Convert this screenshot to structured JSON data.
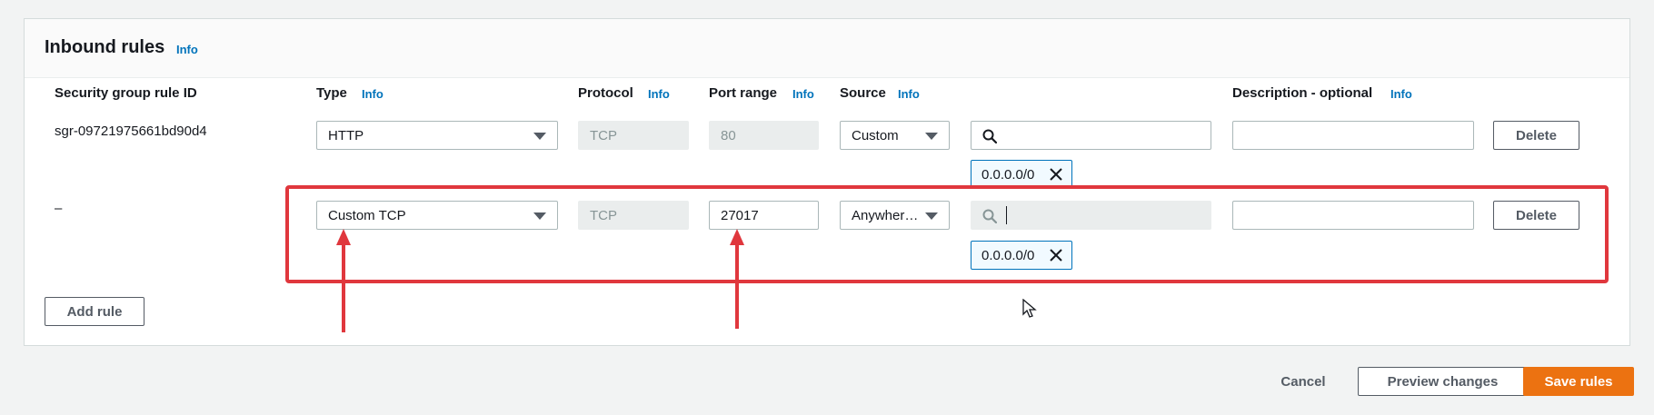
{
  "section": {
    "title": "Inbound rules",
    "info": "Info"
  },
  "columns": {
    "rule_id": "Security group rule ID",
    "type": "Type",
    "protocol": "Protocol",
    "port_range": "Port range",
    "source": "Source",
    "description": "Description - optional",
    "info": "Info"
  },
  "rows": [
    {
      "rule_id": "sgr-09721975661bd90d4",
      "type": "HTTP",
      "protocol": "TCP",
      "port_range": "80",
      "source": "Custom",
      "search_value": "",
      "cidr": "0.0.0.0/0",
      "description": "",
      "delete": "Delete"
    },
    {
      "rule_id": "–",
      "type": "Custom TCP",
      "protocol": "TCP",
      "port_range": "27017",
      "source": "Anywher…",
      "search_value": "",
      "cidr": "0.0.0.0/0",
      "description": "",
      "delete": "Delete"
    }
  ],
  "add_rule": "Add rule",
  "footer": {
    "cancel": "Cancel",
    "preview": "Preview changes",
    "save": "Save rules"
  },
  "colors": {
    "link": "#0073bb",
    "primary": "#ec7211",
    "annotation": "#e0373d"
  }
}
